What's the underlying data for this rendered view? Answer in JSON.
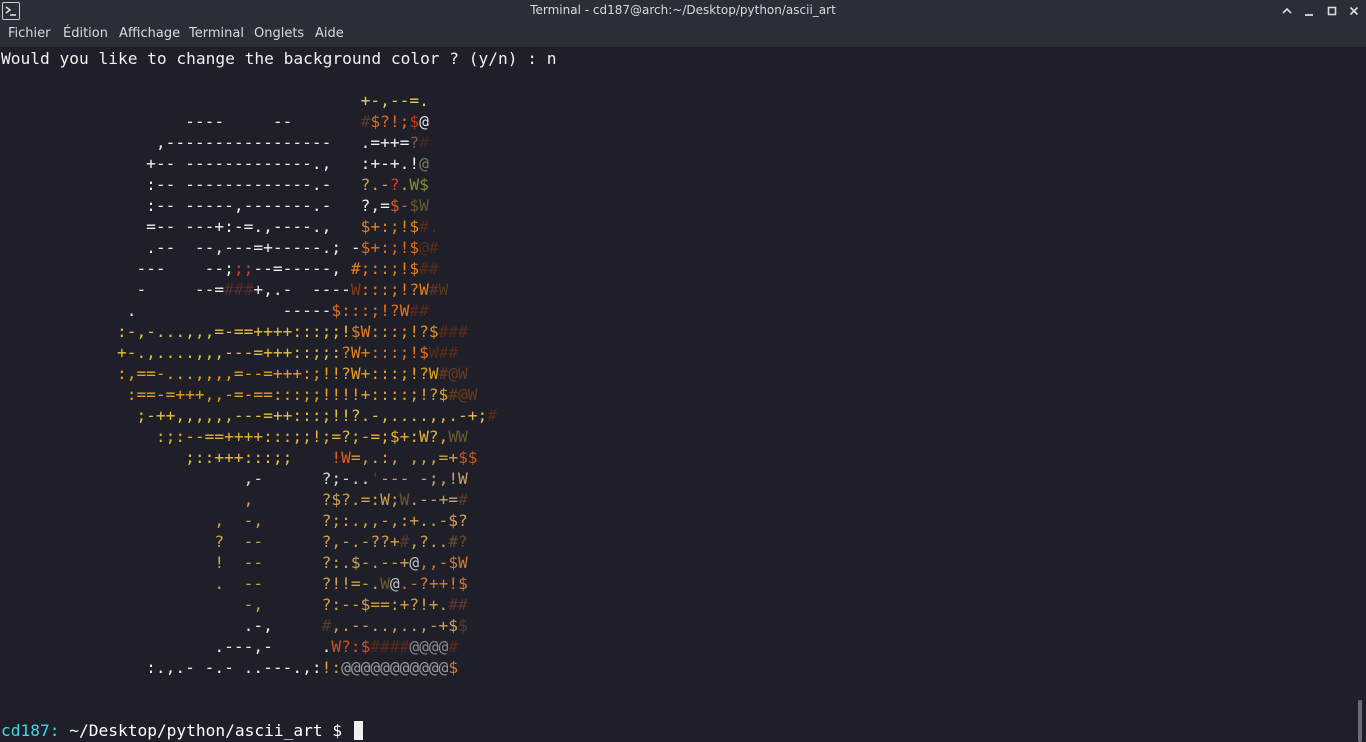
{
  "window": {
    "title": "Terminal - cd187@arch:~/Desktop/python/ascii_art",
    "icons": {
      "app": "terminal-icon",
      "controls": [
        "chevron-up-icon",
        "minimize-icon",
        "maximize-icon",
        "close-icon"
      ]
    }
  },
  "menu": {
    "items": [
      "Fichier",
      "Édition",
      "Affichage",
      "Terminal",
      "Onglets",
      "Aide"
    ]
  },
  "terminal": {
    "question": "Would you like to change the background color ? (y/n) : n",
    "art_lines": [
      [
        [
          "                                     +-,--=.",
          "#e6c86a"
        ]
      ],
      [
        [
          "                   ----     --       ",
          "#eeeeee"
        ],
        [
          "#",
          "#5a3a2a"
        ],
        [
          "$?!;",
          "#e26a1a"
        ],
        [
          "$",
          "#c23a12"
        ],
        [
          "@",
          "#e0e0e0"
        ]
      ],
      [
        [
          "                ,-----------------   .=++=",
          "#eeeeee"
        ],
        [
          "?",
          "#8a5a3a"
        ],
        [
          "#",
          "#3a2a2a"
        ]
      ],
      [
        [
          "               +-- -------------.,   :+-+.!",
          "#eeeeee"
        ],
        [
          "@",
          "#7a7a5a"
        ]
      ],
      [
        [
          "               :-- -------------.-   ",
          "#eeeeee"
        ],
        [
          "?.-",
          "#d7a03a"
        ],
        [
          "?",
          "#e04020"
        ],
        [
          ".",
          "#d7a03a"
        ],
        [
          "W$",
          "#8a8a3a"
        ]
      ],
      [
        [
          "               :-- -----,-------.-   ?,=",
          "#eeeeee"
        ],
        [
          "$-",
          "#d0601a"
        ],
        [
          "$W",
          "#6a5a2a"
        ]
      ],
      [
        [
          "               =-- ---+:-=.,----.,   ",
          "#eeeeee"
        ],
        [
          "$+:;!$",
          "#e8801a"
        ],
        [
          "#.",
          "#5a2a1a"
        ]
      ],
      [
        [
          "               .--  --,---=+-----.; -",
          "#eeeeee"
        ],
        [
          "$+:;!$",
          "#e86a1a"
        ],
        [
          "@#",
          "#5a2a1a"
        ]
      ],
      [
        [
          "              ---    --;",
          "#eeeeee"
        ],
        [
          ";;",
          "#e03a3a"
        ],
        [
          "--=-----, ",
          "#eeeeee"
        ],
        [
          "#;::;!$",
          "#e8801a"
        ],
        [
          "##",
          "#5a2a1a"
        ]
      ],
      [
        [
          "              -     --=",
          "#eeeeee"
        ],
        [
          "###",
          "#5a2a2a"
        ],
        [
          "+,.-  ----",
          "#eeeeee"
        ],
        [
          "W",
          "#8a3a1a"
        ],
        [
          ":::;!?W",
          "#e8801a"
        ],
        [
          "#W",
          "#5a3a1a"
        ]
      ],
      [
        [
          "             .               -----",
          "#eeeeee"
        ],
        [
          "$:::;!?W",
          "#e8701a"
        ],
        [
          "##",
          "#5a2a1a"
        ]
      ],
      [
        [
          "            :-,-...,,,=-==++++:::;;!",
          "#e6c03a"
        ],
        [
          "$W",
          "#e8801a"
        ],
        [
          ":::;!?$",
          "#e8901a"
        ],
        [
          "###",
          "#5a2a1a"
        ]
      ],
      [
        [
          "            +-.,....,,,---=+++::;;:",
          "#e6c03a"
        ],
        [
          "?W+",
          "#e8801a"
        ],
        [
          ":::;!$",
          "#e8701a"
        ],
        [
          "W##",
          "#5a2a1a"
        ]
      ],
      [
        [
          "            :,==-...,,,,=--=+++:;!!?W+:::;!?W",
          "#e8a01a"
        ],
        [
          "#@W",
          "#6a3a1a"
        ]
      ],
      [
        [
          "             :==-=+++,,-=-==:::;;!!!!+::::;!?$",
          "#e8a01a"
        ],
        [
          "#@W",
          "#6a3a1a"
        ]
      ],
      [
        [
          "              ;-++,,,,,,---=++:::;!!?.-,....,,.-+;",
          "#e6c03a"
        ],
        [
          "#",
          "#5a2a1a"
        ]
      ],
      [
        [
          "                :;:--==++++:::;;!;=?;-=;$+:W?,",
          "#e6b03a"
        ],
        [
          "WW",
          "#6a5a2a"
        ]
      ],
      [
        [
          "                   ;::+++:::;;    ",
          "#e6c03a"
        ],
        [
          "!W",
          "#e85a1a"
        ],
        [
          "=,.:, ,,,=+",
          "#d0a04a"
        ],
        [
          "$$",
          "#c05a1a"
        ]
      ],
      [
        [
          "                         ,-      ?;-..",
          "#d7d7d7"
        ],
        [
          "'",
          "#5a3a2a"
        ],
        [
          "--- -;,!W",
          "#c8a06a"
        ]
      ],
      [
        [
          "                         ,       ?$?.=:W;",
          "#d0a04a"
        ],
        [
          "W",
          "#6a5a2a"
        ],
        [
          ".--+=",
          "#c8a06a"
        ],
        [
          "#",
          "#5a3a2a"
        ]
      ],
      [
        [
          "                      ,  -,      ?;:.,,-,:+..-$?",
          "#d0a04a"
        ]
      ],
      [
        [
          "                      ?  --      ?,-.-??+",
          "#d0a04a"
        ],
        [
          "#",
          "#5a3a2a"
        ],
        [
          ",?..",
          "#d0a04a"
        ],
        [
          "#?",
          "#6a4a2a"
        ]
      ],
      [
        [
          "                      !  --      ?:.$-.--+",
          "#d0a04a"
        ],
        [
          "@",
          "#c0c0c0"
        ],
        [
          ",,-$W",
          "#d07a2a"
        ]
      ],
      [
        [
          "                      .  --      ?!!=-.",
          "#d0a04a"
        ],
        [
          "W",
          "#6a5a2a"
        ],
        [
          "@",
          "#c0c0c0"
        ],
        [
          ".-?++!$",
          "#d07a2a"
        ]
      ],
      [
        [
          "                         -,      ?:--$==:+?!+.",
          "#d0a04a"
        ],
        [
          "##",
          "#5a3a2a"
        ]
      ],
      [
        [
          "                         .-,     ",
          "#eeeeee"
        ],
        [
          "#",
          "#5a3a2a"
        ],
        [
          ",.--..,..,-+$",
          "#d0a04a"
        ],
        [
          "$",
          "#5a3a2a"
        ]
      ],
      [
        [
          "                      .---,-     .",
          "#eeeeee"
        ],
        [
          "W?:$",
          "#d0501a"
        ],
        [
          "####",
          "#5a2a1a"
        ],
        [
          "@@@@",
          "#8a8a8a"
        ],
        [
          "#",
          "#5a2a1a"
        ]
      ],
      [
        [
          "               :.,.- -.- ..---.,:",
          "#eeeeee"
        ],
        [
          "!:",
          "#d0a04a"
        ],
        [
          "@@@@@@@@@@@",
          "#9a9a9a"
        ],
        [
          "$",
          "#d07a2a"
        ]
      ]
    ],
    "prompt_user": "cd187:",
    "prompt_path": " ~/Desktop/python/ascii_art $ "
  }
}
